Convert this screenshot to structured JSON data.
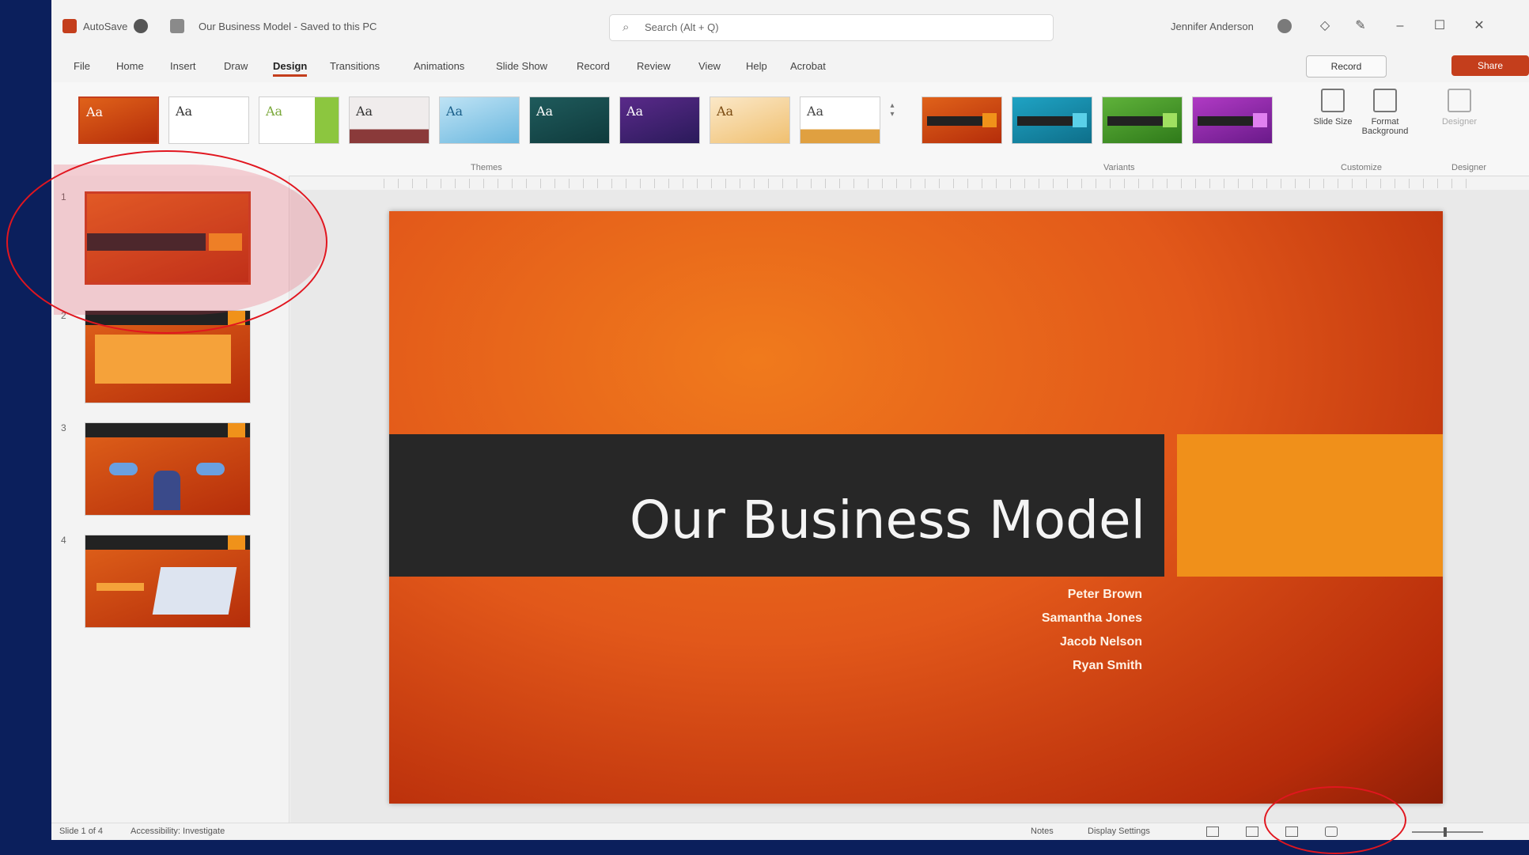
{
  "titlebar": {
    "autosave_label": "AutoSave",
    "doc_title": "Our Business Model - Saved to this PC",
    "search_placeholder": "Search (Alt + Q)",
    "user_name": "Jennifer Anderson",
    "buttons": [
      "minimize-icon",
      "maximize-icon",
      "close-icon"
    ]
  },
  "menu": {
    "tabs": [
      "File",
      "Home",
      "Insert",
      "Draw",
      "Design",
      "Transitions",
      "Animations",
      "Slide Show",
      "Record",
      "Review",
      "View",
      "Help",
      "Acrobat"
    ],
    "active": "Design",
    "record_label": "Record",
    "share_label": "Share"
  },
  "ribbon": {
    "themes_label": "Themes",
    "variants_label": "Variants",
    "customize_label": "Customize",
    "designer_label": "Designer",
    "slide_size_label": "Slide Size",
    "format_background_label": "Format Background",
    "designer_button_label": "Designer",
    "theme_sample": "Aa",
    "colors": {
      "accent": "#c43e1c",
      "slide_orange": "#e2581a",
      "accent_block": "#f0901a",
      "band": "#272727"
    }
  },
  "slides": [
    {
      "number": "1",
      "title": "Our Business Model"
    },
    {
      "number": "2",
      "title": ""
    },
    {
      "number": "3",
      "title": ""
    },
    {
      "number": "4",
      "title": ""
    }
  ],
  "slide": {
    "title": "Our Business Model",
    "presenters": [
      "Peter Brown",
      "Samantha Jones",
      "Jacob Nelson",
      "Ryan Smith"
    ]
  },
  "status": {
    "slide_counter": "Slide 1 of 4",
    "accessibility": "Accessibility: Investigate",
    "notes": "Notes",
    "display_settings": "Display Settings"
  }
}
